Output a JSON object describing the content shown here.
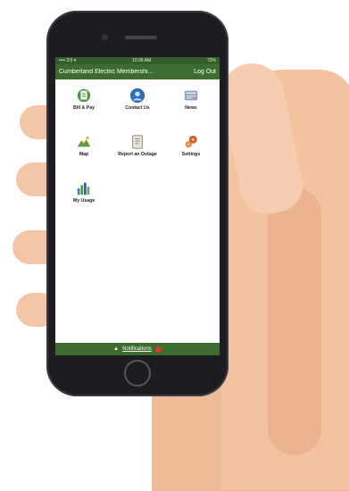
{
  "status_bar": {
    "carrier": "•••• 3:0 ▾",
    "time": "10:36 AM",
    "battery": "72%"
  },
  "app_bar": {
    "title": "Cumberland Electric Membershi...",
    "logout_label": "Log Out"
  },
  "tiles": [
    {
      "label": "Bill & Pay",
      "icon": "bill-pay-icon"
    },
    {
      "label": "Contact Us",
      "icon": "contact-us-icon"
    },
    {
      "label": "News",
      "icon": "news-icon"
    },
    {
      "label": "Map",
      "icon": "map-icon"
    },
    {
      "label": "Report an Outage",
      "icon": "report-outage-icon"
    },
    {
      "label": "Settings",
      "icon": "settings-icon"
    },
    {
      "label": "My Usage",
      "icon": "my-usage-icon"
    }
  ],
  "bottom_bar": {
    "notifications_label": "Notifications"
  },
  "colors": {
    "brand_green": "#3c6c30",
    "status_green": "#335e2a",
    "badge_red": "#d63a2a"
  }
}
